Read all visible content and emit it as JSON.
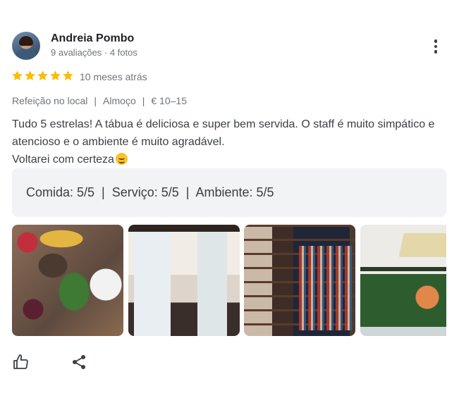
{
  "review": {
    "author": {
      "name": "Andreia Pombo",
      "meta": "9 avaliações · 4 fotos"
    },
    "rating": {
      "stars": 5,
      "max": 5,
      "time": "10 meses atrás"
    },
    "attributes": [
      "Refeição no local",
      "Almoço",
      "€ 10–15"
    ],
    "attribute_separator": "|",
    "text": {
      "line1": "Tudo 5 estrelas! A tábua é deliciosa e super bem servida. O staff é muito simpático e atencioso e o ambiente é muito agradável.",
      "line2": "Voltarei com certeza"
    },
    "sub_ratings": "Comida: 5/5  |  Serviço: 5/5  |  Ambiente: 5/5",
    "photo_count_visible": 4
  },
  "icons": {
    "star": "star-icon",
    "more": "more-vert-icon",
    "like": "thumb-up-icon",
    "share": "share-icon",
    "emoji": "smiling-face-emoji"
  },
  "colors": {
    "star": "#fbbc04",
    "ratings_bg": "#f1f3f4",
    "secondary_text": "#70757a",
    "body_text": "#3c4043"
  }
}
